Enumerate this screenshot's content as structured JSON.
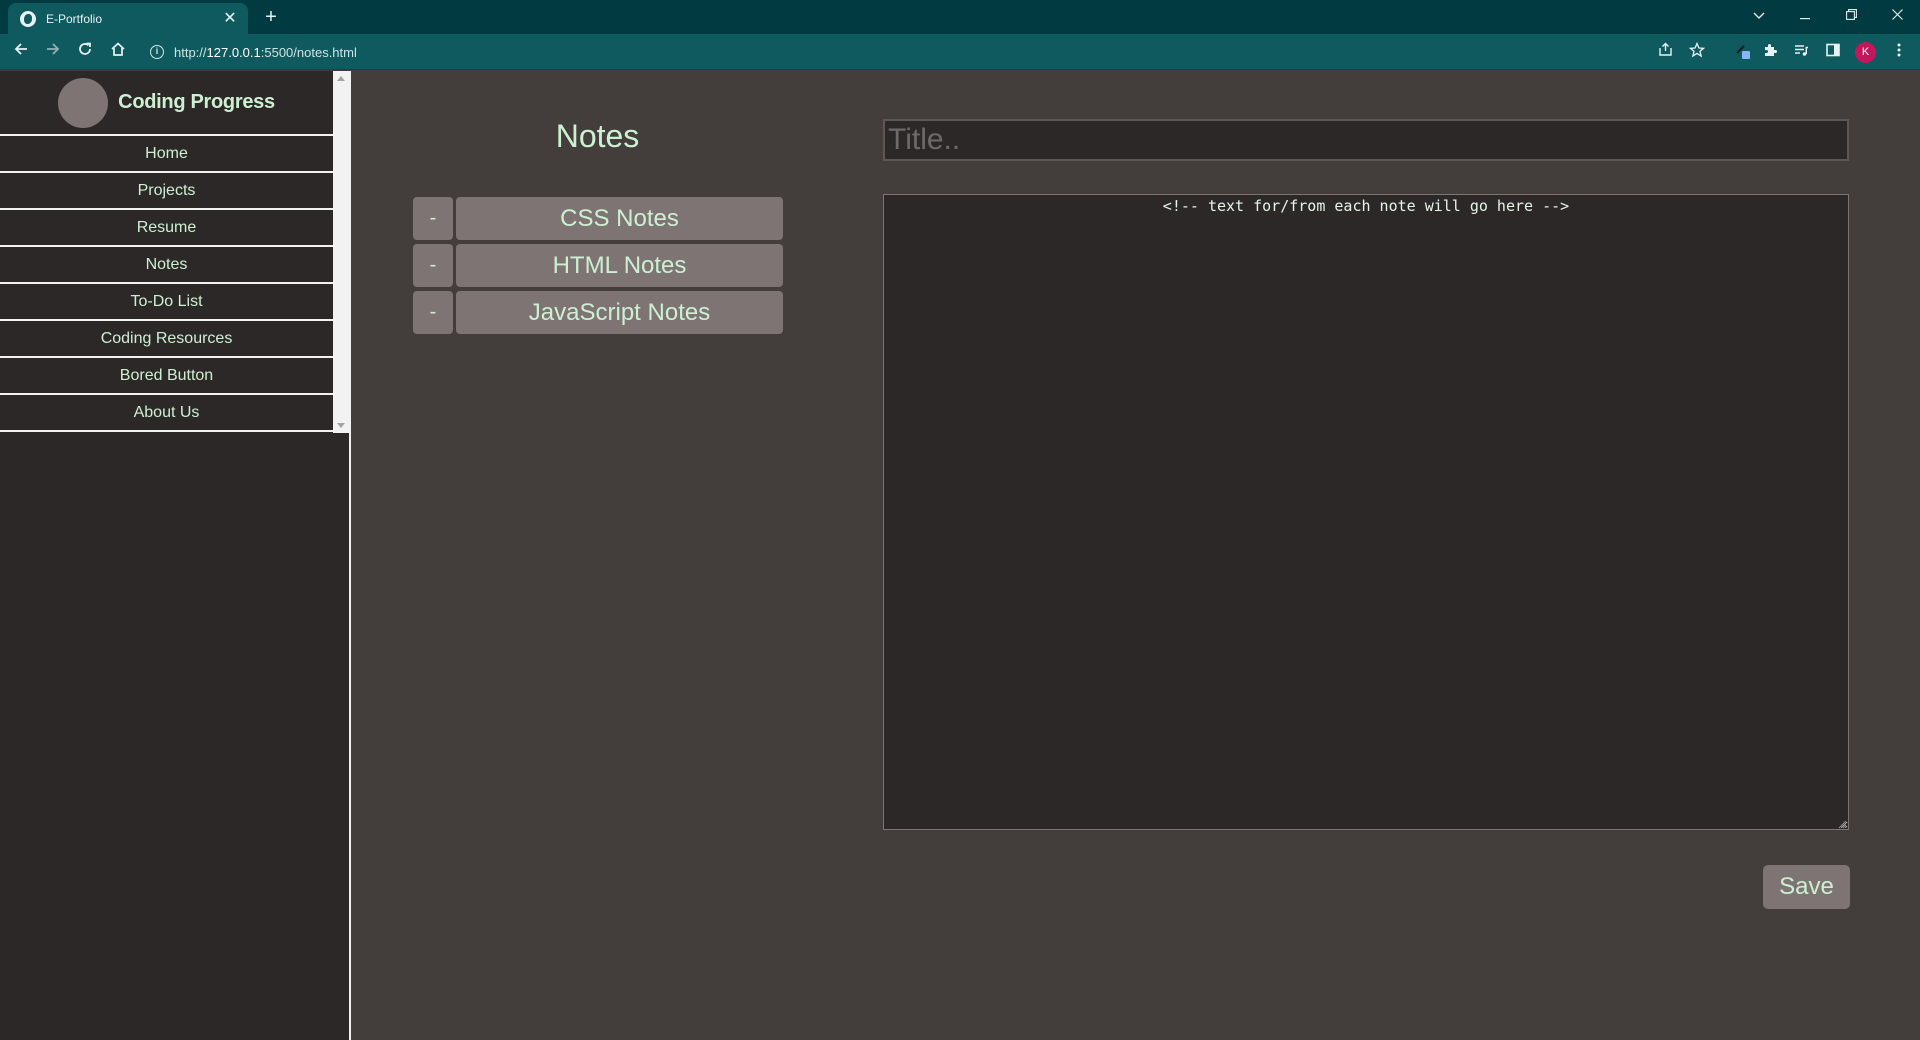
{
  "browser": {
    "tab_title": "E-Portfolio",
    "new_tab_symbol": "+",
    "close_symbol": "✕",
    "url_prefix": "http://",
    "url_host": "127.0.0.1",
    "url_rest": ":5500/notes.html",
    "profile_initial": "K",
    "icons": [
      "globe-favicon-icon",
      "back-icon",
      "forward-icon",
      "reload-icon",
      "home-icon",
      "info-icon",
      "share-icon",
      "star-icon",
      "extension-icon",
      "puzzle-icon",
      "media-icon",
      "side-panel-icon",
      "menu-icon"
    ]
  },
  "sidebar": {
    "title": "Coding Progress",
    "items": [
      {
        "label": "Home"
      },
      {
        "label": "Projects"
      },
      {
        "label": "Resume"
      },
      {
        "label": "Notes"
      },
      {
        "label": "To-Do List"
      },
      {
        "label": "Coding Resources"
      },
      {
        "label": "Bored Button"
      },
      {
        "label": "About Us"
      }
    ]
  },
  "notes": {
    "heading": "Notes",
    "delete_label": "-",
    "items": [
      {
        "label": "CSS Notes"
      },
      {
        "label": "HTML Notes"
      },
      {
        "label": "JavaScript Notes"
      }
    ]
  },
  "editor": {
    "title_placeholder": "Title..",
    "body_text": "<!-- text for/from each note will go here -->",
    "save_label": "Save"
  },
  "colors": {
    "chrome_tabbar": "#023a42",
    "chrome_toolbar": "#0f5a5e",
    "page_background": "#433e3b",
    "sidebar_background": "#2c2827",
    "accent_text": "#cdf0d3",
    "button_background": "#7e7473",
    "profile_avatar": "#c2185b"
  }
}
